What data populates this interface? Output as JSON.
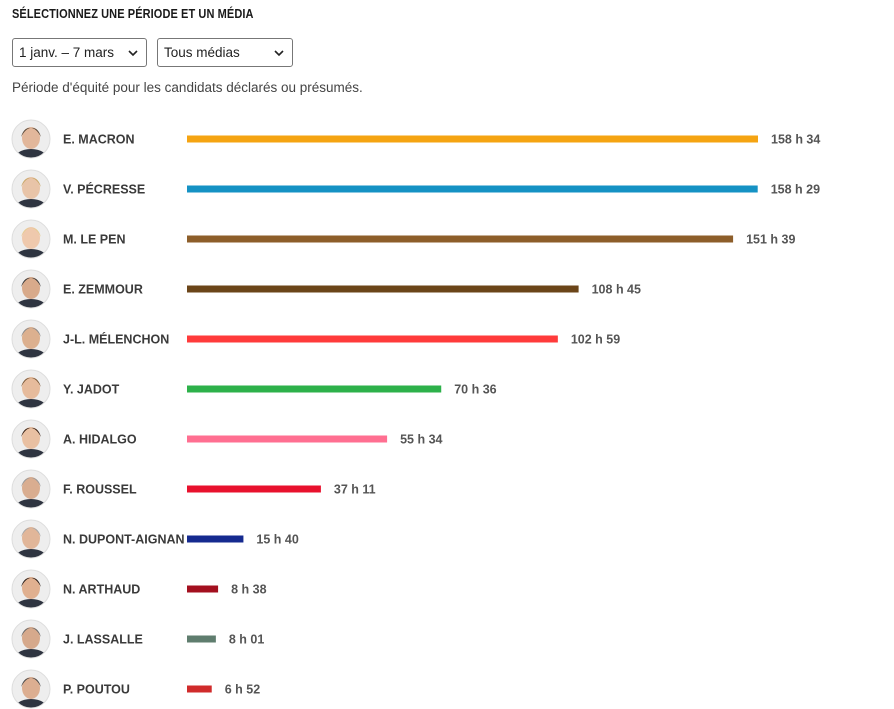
{
  "heading": "SÉLECTIONNEZ UNE PÉRIODE ET UN MÉDIA",
  "filters": {
    "period": "1 janv. – 7 mars",
    "media": "Tous médias"
  },
  "note": "Période d'équité pour les candidats déclarés ou présumés.",
  "chart_data": {
    "type": "bar",
    "orientation": "horizontal",
    "unit": "minutes",
    "categories": [
      "E. MACRON",
      "V. PÉCRESSE",
      "M. LE PEN",
      "E. ZEMMOUR",
      "J-L. MÉLENCHON",
      "Y. JADOT",
      "A. HIDALGO",
      "F. ROUSSEL",
      "N. DUPONT-AIGNAN",
      "N. ARTHAUD",
      "J. LASSALLE",
      "P. POUTOU"
    ],
    "values": [
      9514,
      9509,
      9099,
      6525,
      6179,
      4236,
      3334,
      2231,
      940,
      518,
      481,
      412
    ],
    "labels": [
      "158 h 34",
      "158 h 29",
      "151 h 39",
      "108 h 45",
      "102 h 59",
      "70 h 36",
      "55 h 34",
      "37 h 11",
      "15 h 40",
      "8 h 38",
      "8 h 01",
      "6 h 52"
    ],
    "colors": [
      "#f5a412",
      "#1592c4",
      "#8d5e2a",
      "#6b4519",
      "#ff3b3b",
      "#2db14a",
      "#ff6f91",
      "#e8112d",
      "#152a8f",
      "#a3101f",
      "#5f7d6e",
      "#d02b2b"
    ],
    "xlim": [
      0,
      9514
    ]
  }
}
